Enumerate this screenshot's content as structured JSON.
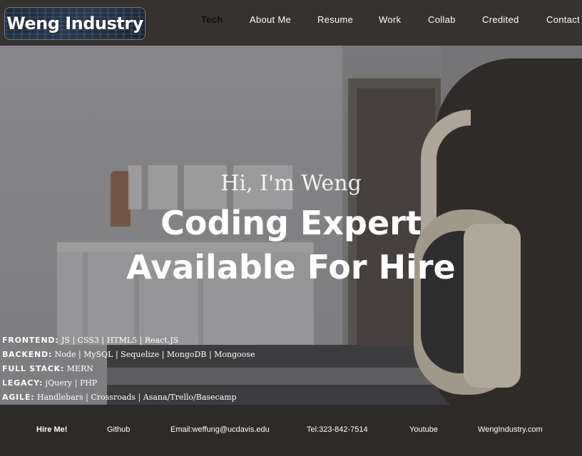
{
  "header": {
    "logo_text": "Weng Industry",
    "nav": [
      {
        "label": "Tech",
        "active": true
      },
      {
        "label": "About Me"
      },
      {
        "label": "Resume"
      },
      {
        "label": "Work"
      },
      {
        "label": "Collab"
      },
      {
        "label": "Credited"
      },
      {
        "label": "Contact"
      }
    ]
  },
  "hero": {
    "greeting": "Hi, I'm Weng",
    "headline_line1": "Coding Expert",
    "headline_line2": "Available For Hire"
  },
  "skills": [
    {
      "label": "FRONTEND:",
      "value": " JS | CSS3 | HTML5 | React.JS"
    },
    {
      "label": "BACKEND:",
      "value": " Node | MySQL | Sequelize | MongoDB | Mongoose"
    },
    {
      "label": "FULL STACK:",
      "value": " MERN"
    },
    {
      "label": "LEGACY:",
      "value": " jQuery | PHP"
    },
    {
      "label": "AGILE:",
      "value": " Handlebars | Crossroads | Asana/Trello/Basecamp"
    }
  ],
  "footer": {
    "hire": "Hire Me!",
    "github": "Github",
    "email": "Email:weffung@ucdavis.edu",
    "tel": "Tel:323-842-7514",
    "youtube": "Youtube",
    "website": "WengIndustry.com"
  },
  "colors": {
    "topbar": "#353230",
    "footer": "#2d2a28",
    "active_nav": "#111111"
  }
}
